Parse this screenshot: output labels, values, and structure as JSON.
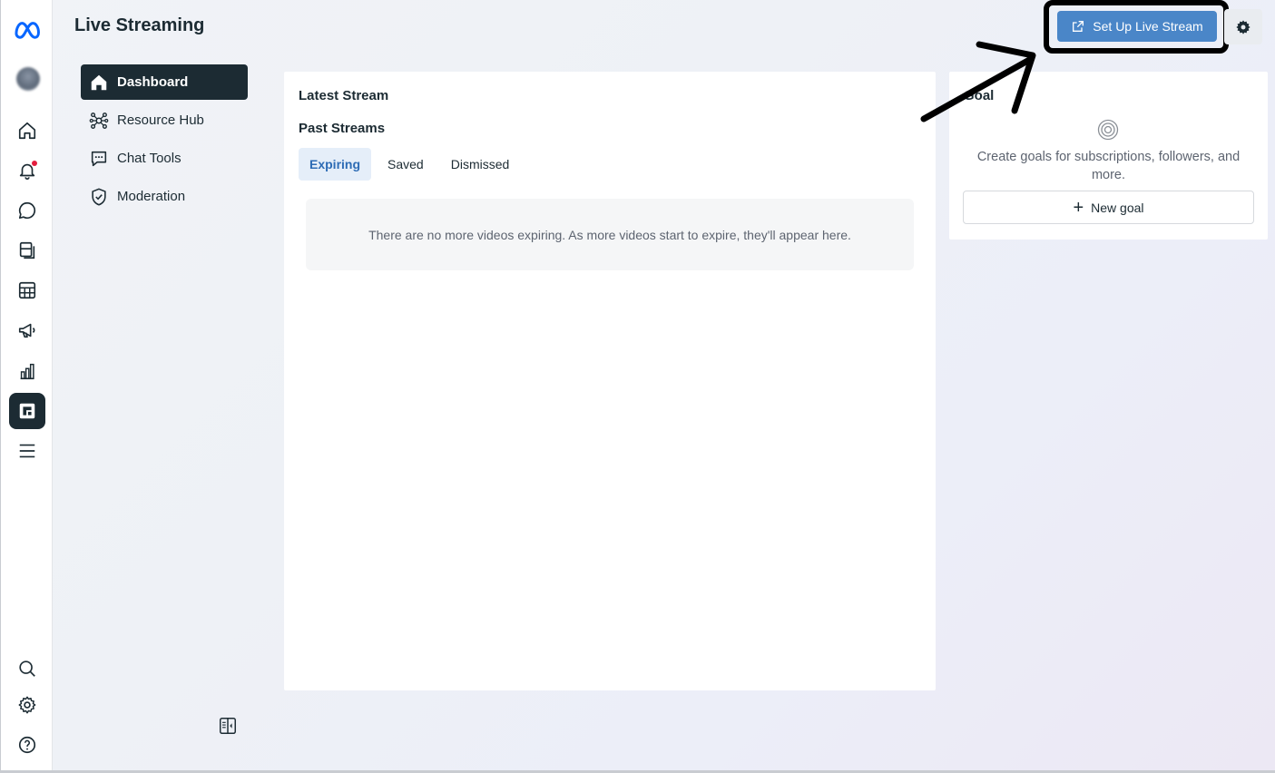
{
  "header": {
    "title": "Live Streaming"
  },
  "rail": {
    "items": [
      {
        "icon": "meta-logo-icon"
      },
      {
        "icon": "avatar"
      },
      {
        "icon": "home-icon"
      },
      {
        "icon": "bell-icon",
        "badge": true
      },
      {
        "icon": "chat-bubble-icon"
      },
      {
        "icon": "content-icon"
      },
      {
        "icon": "table-icon"
      },
      {
        "icon": "megaphone-icon"
      },
      {
        "icon": "insights-icon"
      },
      {
        "icon": "live-streaming-icon",
        "active": true
      },
      {
        "icon": "menu-icon"
      },
      {
        "icon": "search-icon"
      },
      {
        "icon": "gear-icon"
      },
      {
        "icon": "help-icon"
      }
    ]
  },
  "subnav": {
    "items": [
      {
        "label": "Dashboard",
        "icon": "home-filled-icon",
        "active": true
      },
      {
        "label": "Resource Hub",
        "icon": "network-icon"
      },
      {
        "label": "Chat Tools",
        "icon": "chat-dots-icon"
      },
      {
        "label": "Moderation",
        "icon": "shield-check-icon"
      }
    ]
  },
  "main": {
    "latest_title": "Latest Stream",
    "past_title": "Past Streams",
    "tabs": [
      {
        "label": "Expiring",
        "active": true
      },
      {
        "label": "Saved"
      },
      {
        "label": "Dismissed"
      }
    ],
    "empty_message": "There are no more videos expiring. As more videos start to expire, they'll appear here."
  },
  "goal": {
    "title": "Goal",
    "description": "Create goals for subscriptions, followers, and more.",
    "new_goal_label": "New goal"
  },
  "toolbar": {
    "setup_label": "Set Up Live Stream",
    "settings_icon": "gear-icon"
  },
  "colors": {
    "accent": "#4a86c8",
    "dark": "#1c2b33",
    "tab_active_bg": "#e5eef9",
    "notification": "#e41e3f"
  }
}
